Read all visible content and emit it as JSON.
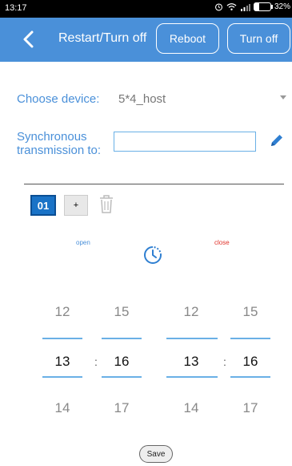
{
  "status_bar": {
    "time": "13:17",
    "battery": "32%"
  },
  "header": {
    "title": "Restart/Turn off",
    "reboot_label": "Reboot",
    "turnoff_label": "Turn off"
  },
  "device": {
    "label": "Choose device:",
    "value": "5*4_host"
  },
  "sync": {
    "label_line1": "Synchronous",
    "label_line2": "transmission to:",
    "value": ""
  },
  "tabs": {
    "active_label": "01",
    "add_label": "+"
  },
  "timer": {
    "open_label": "open",
    "close_label": "close"
  },
  "open_time": {
    "hour": {
      "prev": "12",
      "selected": "13",
      "next": "14"
    },
    "minute": {
      "prev": "15",
      "selected": "16",
      "next": "17"
    }
  },
  "close_time": {
    "hour": {
      "prev": "12",
      "selected": "13",
      "next": "14"
    },
    "minute": {
      "prev": "15",
      "selected": "16",
      "next": "17"
    }
  },
  "separator": ":",
  "save_label": "Save",
  "colors": {
    "accent": "#4a90d9",
    "close": "#e0332b",
    "tab_active": "#1a73c7"
  }
}
